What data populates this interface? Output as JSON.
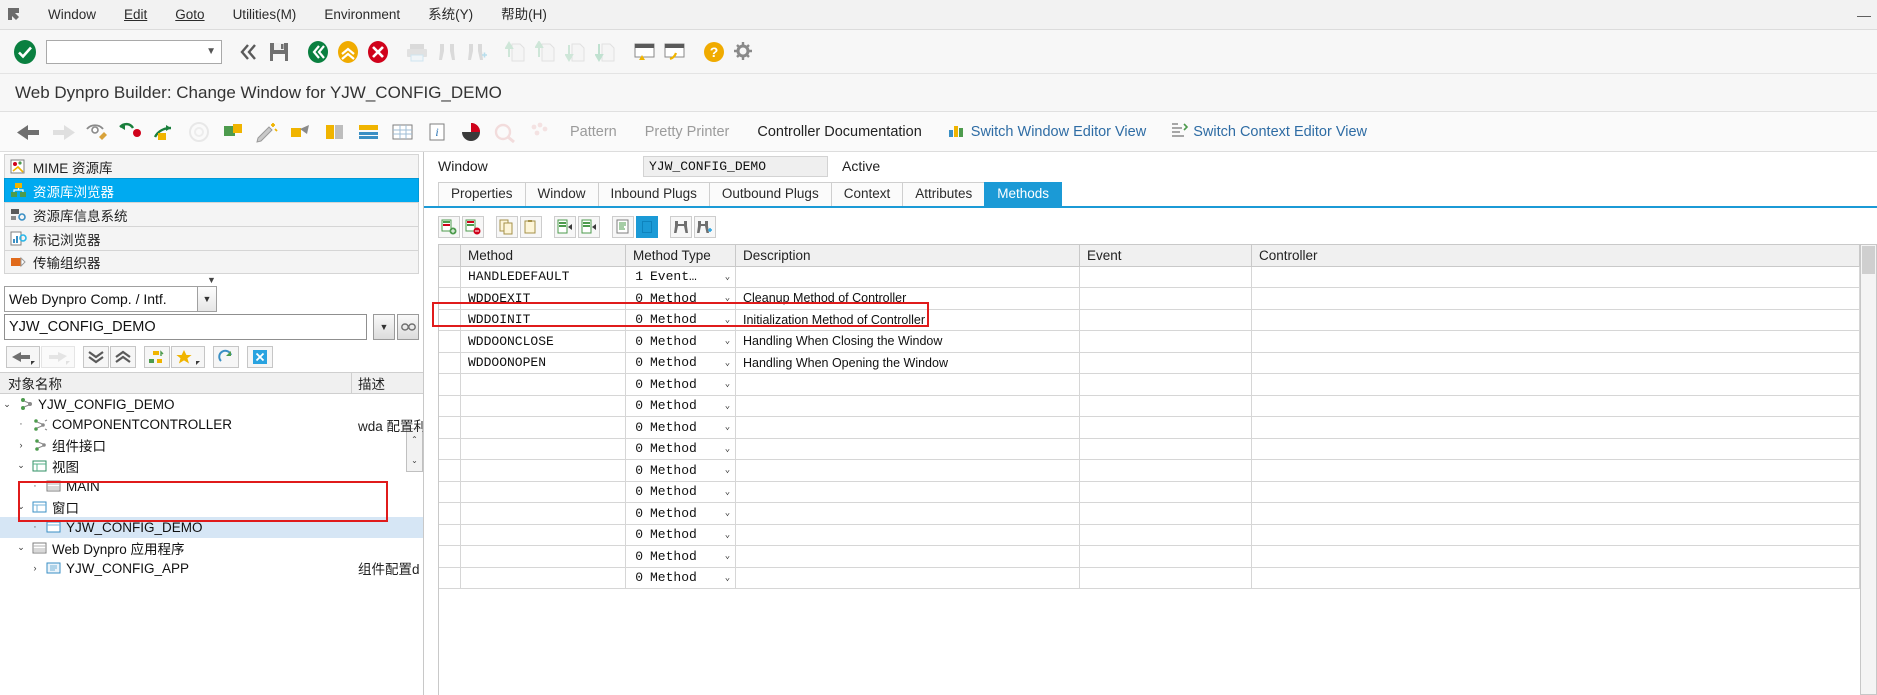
{
  "menubar": {
    "logo_icon": "sap-pointer-icon",
    "items": [
      {
        "label": "Window",
        "accel": ""
      },
      {
        "label": "Edit",
        "accel": "E"
      },
      {
        "label": "Goto",
        "accel": "G"
      },
      {
        "label": "Utilities(M)",
        "accel": "M"
      },
      {
        "label": "Environment",
        "accel": "v"
      },
      {
        "label": "系统(Y)",
        "accel": "Y"
      },
      {
        "label": "帮助(H)",
        "accel": "H"
      }
    ],
    "window_controls": [
      "minimize",
      "maximize",
      "close"
    ]
  },
  "toolbar_primary": {
    "enter_icon": "green-check-icon",
    "command_field": {
      "value": "",
      "placeholder": ""
    },
    "buttons": [
      {
        "name": "back-chevrons-icon",
        "label": "«",
        "enabled": true
      },
      {
        "name": "save-icon",
        "label": "Save",
        "enabled": true
      },
      {
        "name": "back-green-icon",
        "label": "Back",
        "enabled": true
      },
      {
        "name": "exit-up-icon",
        "label": "Exit",
        "enabled": true
      },
      {
        "name": "cancel-red-icon",
        "label": "Cancel",
        "enabled": true
      },
      {
        "name": "print-icon",
        "label": "Print",
        "enabled": false
      },
      {
        "name": "find-icon",
        "label": "Find",
        "enabled": false
      },
      {
        "name": "find-next-icon",
        "label": "Find Next",
        "enabled": false
      },
      {
        "name": "first-page-icon",
        "label": "First Page",
        "enabled": false
      },
      {
        "name": "previous-page-icon",
        "label": "Previous Page",
        "enabled": false
      },
      {
        "name": "next-page-icon",
        "label": "Next Page",
        "enabled": false
      },
      {
        "name": "last-page-icon",
        "label": "Last Page",
        "enabled": false
      },
      {
        "name": "create-session-icon",
        "label": "Create New Session",
        "enabled": true
      },
      {
        "name": "create-shortcut-icon",
        "label": "Create Shortcut",
        "enabled": true
      },
      {
        "name": "help-icon",
        "label": "Help",
        "enabled": true
      },
      {
        "name": "customize-local-layout-icon",
        "label": "Customize Local Layout",
        "enabled": true
      }
    ]
  },
  "title": "Web Dynpro Builder: Change Window for YJW_CONFIG_DEMO",
  "toolbar_secondary": {
    "icon_buttons": [
      {
        "name": "back-arrow-icon",
        "enabled": true
      },
      {
        "name": "forward-arrow-icon",
        "enabled": false
      },
      {
        "name": "display-change-icon",
        "enabled": true
      },
      {
        "name": "check-syntax-icon",
        "enabled": true
      },
      {
        "name": "activate-icon",
        "enabled": true
      },
      {
        "name": "inactive-objects-icon",
        "enabled": false
      },
      {
        "name": "test-component-icon",
        "enabled": true
      },
      {
        "name": "where-used-icon",
        "enabled": true
      },
      {
        "name": "navigate-icon",
        "enabled": true
      },
      {
        "name": "layout-designer-icon",
        "enabled": true
      },
      {
        "name": "properties-icon",
        "enabled": true
      },
      {
        "name": "table-view-icon",
        "enabled": true
      },
      {
        "name": "info-icon",
        "enabled": true
      },
      {
        "name": "pie-chart-icon",
        "enabled": true
      },
      {
        "name": "trace-icon",
        "enabled": false
      },
      {
        "name": "configuration-icon",
        "enabled": false
      }
    ],
    "text_buttons": [
      {
        "label": "Pattern",
        "enabled": false
      },
      {
        "label": "Pretty Printer",
        "enabled": false
      },
      {
        "label": "Controller Documentation",
        "enabled": true
      }
    ],
    "link_buttons": [
      {
        "label": "Switch Window Editor View",
        "icon": "switch-window-editor-icon"
      },
      {
        "label": "Switch Context Editor View",
        "icon": "switch-context-editor-icon"
      }
    ]
  },
  "sidebar": {
    "nav_items": [
      {
        "label": "MIME 资源库",
        "icon": "mime-repository-icon",
        "selected": false
      },
      {
        "label": "资源库浏览器",
        "icon": "repository-browser-icon",
        "selected": true
      },
      {
        "label": "资源库信息系统",
        "icon": "repository-info-system-icon",
        "selected": false
      },
      {
        "label": "标记浏览器",
        "icon": "tag-browser-icon",
        "selected": false
      },
      {
        "label": "传输组织器",
        "icon": "transport-organizer-icon",
        "selected": false
      }
    ],
    "collapse_caret": "▼",
    "object_type_combo": {
      "value": "Web Dynpro Comp. / Intf.",
      "caret": "▼"
    },
    "object_name_field": {
      "value": "YJW_CONFIG_DEMO",
      "placeholder": ""
    },
    "object_name_buttons": [
      {
        "name": "dropdown-history-button",
        "label": "▼"
      },
      {
        "name": "browse-object-button",
        "label": "display-icon"
      }
    ],
    "scroll_stub": {
      "up": "⌃",
      "down": "⌄"
    },
    "tree_toolbar": [
      {
        "name": "tree-back-button",
        "enabled": true,
        "icon": "left-arrow-icon",
        "has_menu": true
      },
      {
        "name": "tree-forward-button",
        "enabled": false,
        "icon": "right-arrow-icon",
        "has_menu": true
      },
      {
        "name": "tree-expand-all-button",
        "enabled": true,
        "icon": "double-chevron-down-icon"
      },
      {
        "name": "tree-collapse-all-button",
        "enabled": true,
        "icon": "double-chevron-up-icon"
      },
      {
        "name": "tree-hierarchy-button",
        "enabled": true,
        "icon": "hierarchy-icon"
      },
      {
        "name": "tree-favorites-button",
        "enabled": true,
        "icon": "star-icon",
        "has_menu": true
      },
      {
        "name": "tree-refresh-button",
        "enabled": true,
        "icon": "refresh-icon"
      },
      {
        "name": "tree-close-button",
        "enabled": true,
        "icon": "close-x-icon"
      }
    ],
    "tree_headers": {
      "name": "对象名称",
      "description": "描述"
    },
    "tree_rows": [
      {
        "label": "YJW_CONFIG_DEMO",
        "desc": "",
        "indent": 0,
        "twisty": "expanded",
        "icon": "web-dynpro-component-icon",
        "highlight": false
      },
      {
        "label": "COMPONENTCONTROLLER",
        "desc": "wda 配置利",
        "indent": 1,
        "twisty": "leaf",
        "icon": "component-controller-icon",
        "highlight": false
      },
      {
        "label": "组件接口",
        "desc": "",
        "indent": 1,
        "twisty": "collapsed",
        "icon": "component-interface-icon",
        "highlight": false
      },
      {
        "label": "视图",
        "desc": "",
        "indent": 1,
        "twisty": "expanded",
        "icon": "views-folder-icon",
        "highlight": false
      },
      {
        "label": "MAIN",
        "desc": "",
        "indent": 2,
        "twisty": "leaf",
        "icon": "view-icon",
        "highlight": false
      },
      {
        "label": "窗口",
        "desc": "",
        "indent": 1,
        "twisty": "expanded",
        "icon": "windows-folder-icon",
        "highlight": false
      },
      {
        "label": "YJW_CONFIG_DEMO",
        "desc": "",
        "indent": 2,
        "twisty": "leaf",
        "icon": "window-icon",
        "highlight": true
      },
      {
        "label": "Web Dynpro 应用程序",
        "desc": "",
        "indent": 1,
        "twisty": "expanded",
        "icon": "application-folder-icon",
        "highlight": false
      },
      {
        "label": "YJW_CONFIG_APP",
        "desc": "组件配置d",
        "indent": 2,
        "twisty": "collapsed",
        "icon": "application-icon",
        "highlight": false
      }
    ]
  },
  "editor": {
    "header": {
      "label": "Window",
      "value": "YJW_CONFIG_DEMO",
      "status": "Active"
    },
    "tabs": [
      {
        "label": "Properties",
        "active": false
      },
      {
        "label": "Window",
        "active": false
      },
      {
        "label": "Inbound Plugs",
        "active": false
      },
      {
        "label": "Outbound Plugs",
        "active": false
      },
      {
        "label": "Context",
        "active": false
      },
      {
        "label": "Attributes",
        "active": false
      },
      {
        "label": "Methods",
        "active": true
      }
    ],
    "table_toolbar": [
      {
        "name": "insert-row-button",
        "icon": "insert-row-green-icon",
        "active": false
      },
      {
        "name": "delete-row-button",
        "icon": "delete-row-red-icon",
        "active": false
      },
      {
        "name": "copy-row-button",
        "icon": "copy-icon",
        "active": false
      },
      {
        "name": "paste-row-button",
        "icon": "paste-icon",
        "active": false
      },
      {
        "name": "cut-row-button",
        "icon": "cut-row-icon",
        "active": false
      },
      {
        "name": "insert-cut-row-button",
        "icon": "insert-cut-row-icon",
        "active": false
      },
      {
        "name": "method-source-button",
        "icon": "source-code-icon",
        "active": false
      },
      {
        "name": "toggle-highlight-button",
        "icon": "highlight-icon",
        "active": true
      },
      {
        "name": "find-button",
        "icon": "binoculars-icon",
        "active": false
      },
      {
        "name": "find-next-button",
        "icon": "binoculars-plus-icon",
        "active": false
      }
    ],
    "columns": [
      "Method",
      "Method Type",
      "Description",
      "Event",
      "Controller"
    ],
    "rows": [
      {
        "method": "HANDLEDEFAULT",
        "type_num": "1",
        "type_text": "Event…",
        "description": "",
        "event": "",
        "controller": "",
        "outlined": false
      },
      {
        "method": "WDDOEXIT",
        "type_num": "0",
        "type_text": "Method",
        "description": "Cleanup Method of Controller",
        "event": "",
        "controller": "",
        "outlined": false
      },
      {
        "method": "WDDOINIT",
        "type_num": "0",
        "type_text": "Method",
        "description": "Initialization Method of Controller",
        "event": "",
        "controller": "",
        "outlined": true
      },
      {
        "method": "WDDOONCLOSE",
        "type_num": "0",
        "type_text": "Method",
        "description": "Handling When Closing the Window",
        "event": "",
        "controller": "",
        "outlined": false
      },
      {
        "method": "WDDOONOPEN",
        "type_num": "0",
        "type_text": "Method",
        "description": "Handling When Opening the Window",
        "event": "",
        "controller": "",
        "outlined": false
      },
      {
        "method": "",
        "type_num": "0",
        "type_text": "Method",
        "description": "",
        "event": "",
        "controller": "",
        "outlined": false
      },
      {
        "method": "",
        "type_num": "0",
        "type_text": "Method",
        "description": "",
        "event": "",
        "controller": "",
        "outlined": false
      },
      {
        "method": "",
        "type_num": "0",
        "type_text": "Method",
        "description": "",
        "event": "",
        "controller": "",
        "outlined": false
      },
      {
        "method": "",
        "type_num": "0",
        "type_text": "Method",
        "description": "",
        "event": "",
        "controller": "",
        "outlined": false
      },
      {
        "method": "",
        "type_num": "0",
        "type_text": "Method",
        "description": "",
        "event": "",
        "controller": "",
        "outlined": false
      },
      {
        "method": "",
        "type_num": "0",
        "type_text": "Method",
        "description": "",
        "event": "",
        "controller": "",
        "outlined": false
      },
      {
        "method": "",
        "type_num": "0",
        "type_text": "Method",
        "description": "",
        "event": "",
        "controller": "",
        "outlined": false
      },
      {
        "method": "",
        "type_num": "0",
        "type_text": "Method",
        "description": "",
        "event": "",
        "controller": "",
        "outlined": false
      },
      {
        "method": "",
        "type_num": "0",
        "type_text": "Method",
        "description": "",
        "event": "",
        "controller": "",
        "outlined": false
      },
      {
        "method": "",
        "type_num": "0",
        "type_text": "Method",
        "description": "",
        "event": "",
        "controller": "",
        "outlined": false
      }
    ]
  },
  "colors": {
    "accent": "#1b9ad6",
    "selection": "#00aaf0",
    "tree_highlight": "#d6e6f5",
    "annotation_red": "#e01b1b",
    "link_blue": "#2e6ca4"
  }
}
